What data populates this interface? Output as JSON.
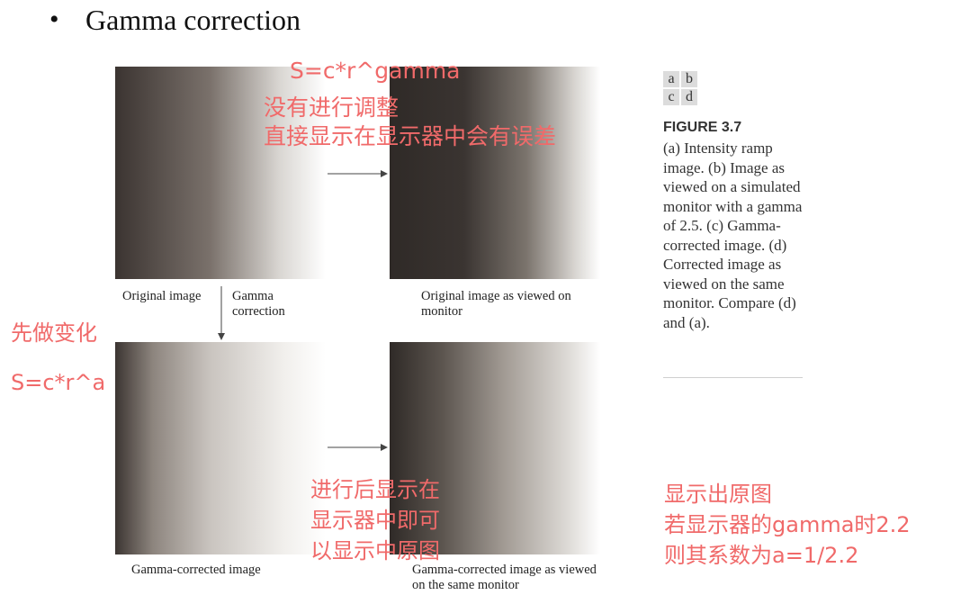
{
  "heading": {
    "bullet": "•",
    "title": "Gamma correction"
  },
  "figure": {
    "grid": [
      "a",
      "b",
      "c",
      "d"
    ],
    "title": "FIGURE 3.7",
    "description": "(a) Intensity ramp image. (b) Image as viewed on a simulated monitor with a gamma of 2.5. (c) Gamma-corrected image. (d) Corrected image as viewed on the same monitor. Compare (d) and (a).",
    "captions": {
      "a": "Original image",
      "gamma": "Gamma correction",
      "b": "Original image as viewed on monitor",
      "c": "Gamma-corrected image",
      "d": "Gamma-corrected image as viewed on the same monitor"
    }
  },
  "annotations": {
    "formula_top": "S=c*r^gamma",
    "no_adjust_line1": "没有进行调整",
    "no_adjust_line2": "直接显示在显示器中会有误差",
    "first_transform": "先做变化",
    "formula_left": "S=c*r^a",
    "after_line1": "进行后显示在",
    "after_line2": "显示器中即可",
    "after_line3": "以显示中原图",
    "right_line1": "显示出原图",
    "right_line2": "若显示器的gamma时2.2",
    "right_line3": "则其系数为a=1/2.2"
  },
  "colors": {
    "annotation": "#f06a6a",
    "grid_bg": "#dcdcdc"
  }
}
